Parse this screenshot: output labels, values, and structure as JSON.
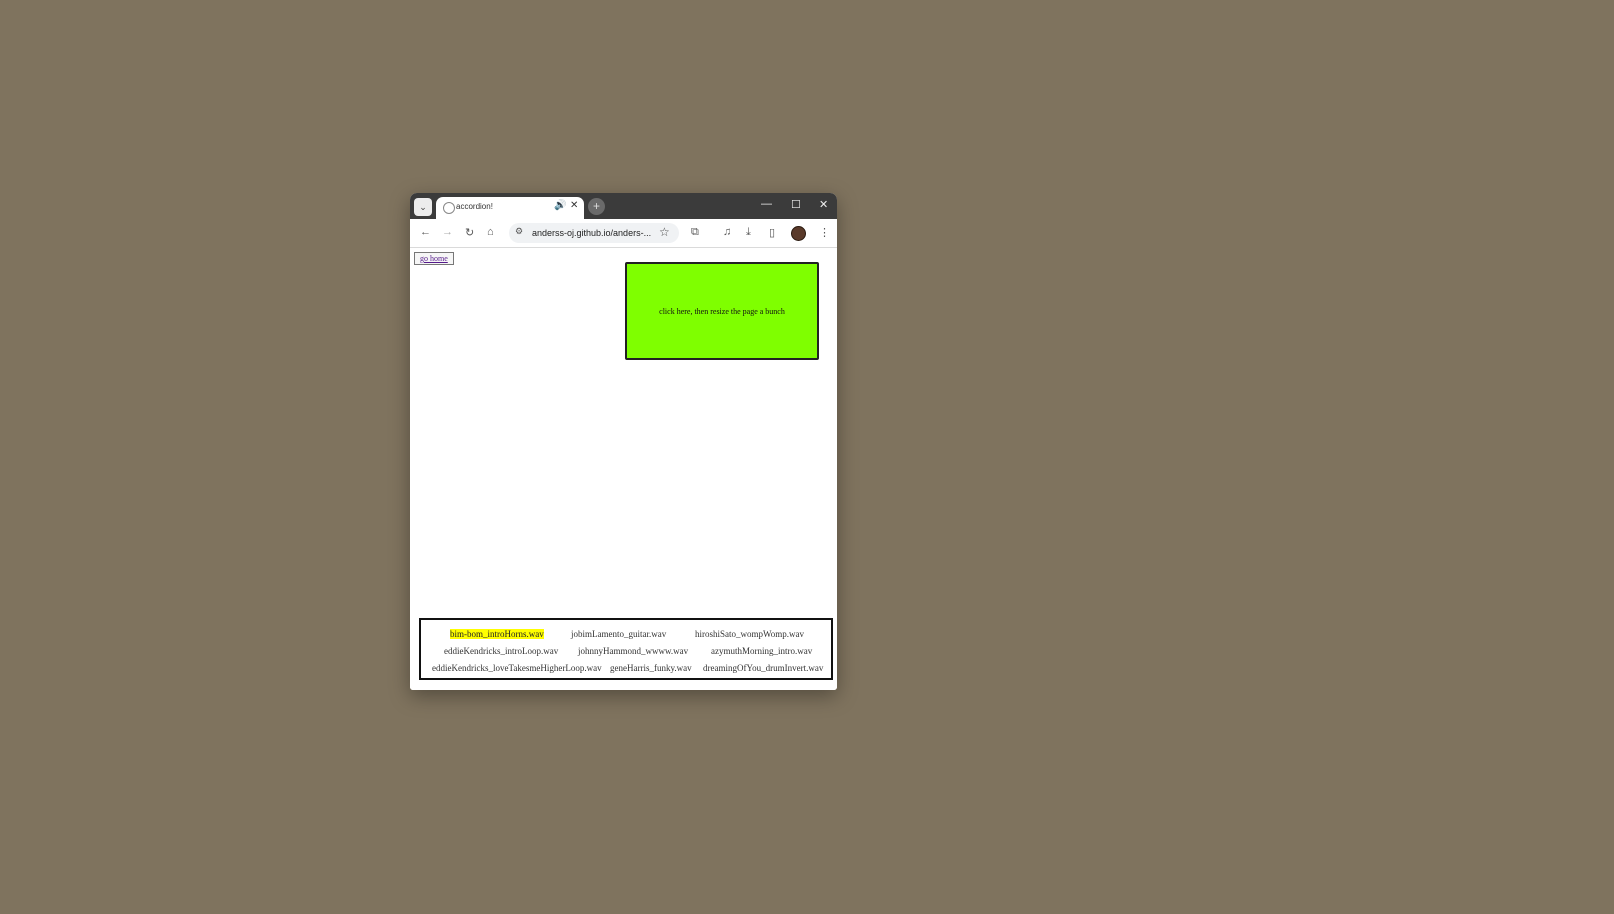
{
  "browser": {
    "tab_title": "accordion!",
    "url": "anderss-oj.github.io/anders-...",
    "icons": {
      "tab_search": "chevron-down-icon",
      "audio": "speaker-icon",
      "close": "close-icon",
      "new_tab": "plus-icon",
      "minimize": "minimize-icon",
      "maximize": "maximize-icon",
      "window_close": "close-icon",
      "back": "back-arrow-icon",
      "forward": "forward-arrow-icon",
      "reload": "reload-icon",
      "home": "home-icon",
      "site_info": "site-info-icon",
      "bookmark": "star-icon",
      "extensions": "puzzle-icon",
      "media": "media-control-icon",
      "downloads": "download-icon",
      "side_panel": "side-panel-icon",
      "menu": "kebab-menu-icon"
    }
  },
  "page": {
    "go_home": "go home",
    "green_box_text": "click here, then resize the page a bunch",
    "green_color": "#7fff00",
    "highlight_color": "#ffff00",
    "files": [
      "bim-bom_introHorns.wav",
      "jobimLamento_guitar.wav",
      "hiroshiSato_wompWomp.wav",
      "eddieKendricks_introLoop.wav",
      "johnnyHammond_wwww.wav",
      "azymuthMorning_intro.wav",
      "eddieKendricks_loveTakesmeHigherLoop.wav",
      "geneHarris_funky.wav",
      "dreamingOfYou_drumInvert.wav"
    ],
    "active_file": "bim-bom_introHorns.wav"
  }
}
